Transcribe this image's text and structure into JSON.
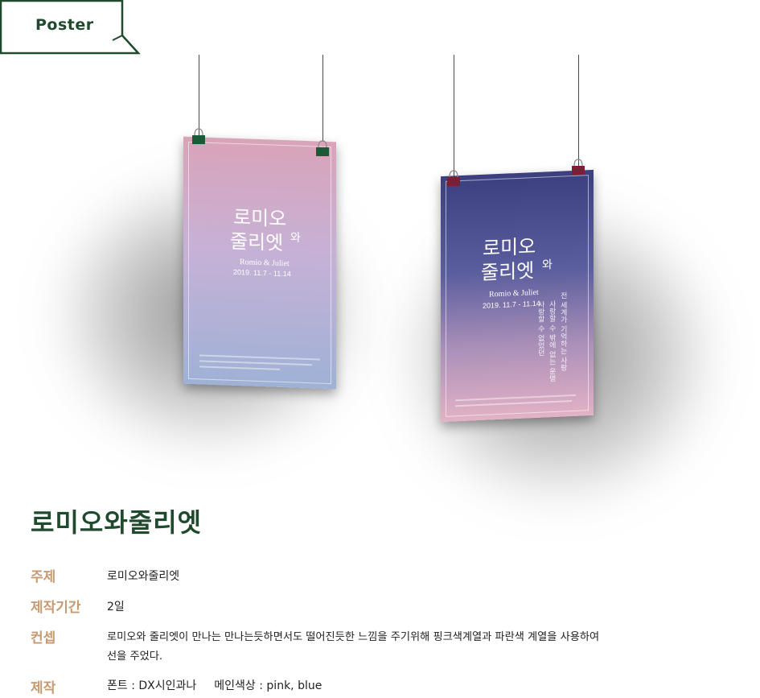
{
  "tag": {
    "label": "Poster"
  },
  "posters": [
    {
      "title_line1": "로미오",
      "title_line2": "줄리엣",
      "title_wa": "와",
      "subtitle": "Romio & Juliet",
      "date": "2019. 11.7 - 11.14",
      "color_top": "#d9a3b8",
      "color_bottom": "#9fb1d6"
    },
    {
      "title_line1": "로미오",
      "title_line2": "줄리엣",
      "title_wa": "와",
      "subtitle": "Romio & Juliet",
      "date": "2019. 11.7 - 11.14",
      "vertical_1": "전 세계가 기억하는 사랑",
      "vertical_2": "사랑할 수 밖에 없는 운명",
      "vertical_3": "사랑할 수 없었던",
      "color_top": "#3b3f7e",
      "color_bottom": "#e3b2c6"
    }
  ],
  "project": {
    "title": "로미오와줄리엣",
    "rows": [
      {
        "label": "주제",
        "value": "로미오와줄리엣"
      },
      {
        "label": "제작기간",
        "value": "2일"
      },
      {
        "label": "컨셉",
        "value_line1": "로미오와 줄리엣이 만나는 만나는듯하면서도 떨어진듯한 느낌을 주기위해 핑크색계열과 파란색 계열을 사용하여",
        "value_line2": "선을 주었다."
      },
      {
        "label": "제작",
        "font_label": "폰트 : DX시인과나",
        "color_label": "메인색상 : pink, blue"
      }
    ]
  },
  "colors": {
    "brand_green": "#1f4a2e",
    "label_tan": "#c69a72"
  }
}
